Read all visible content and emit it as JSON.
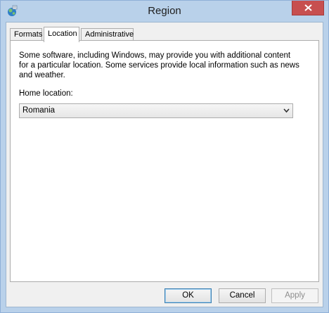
{
  "window": {
    "title": "Region",
    "close_icon": "close-icon",
    "app_icon": "region-globe-icon"
  },
  "tabs": [
    {
      "label": "Formats",
      "active": false
    },
    {
      "label": "Location",
      "active": true
    },
    {
      "label": "Administrative",
      "active": false
    }
  ],
  "location_panel": {
    "description": "Some software, including Windows, may provide you with additional content for a particular location. Some services provide local information such as news and weather.",
    "home_location_label": "Home location:",
    "home_location_value": "Romania"
  },
  "buttons": {
    "ok": "OK",
    "cancel": "Cancel",
    "apply": "Apply"
  },
  "colors": {
    "title_bar": "#b9d1ea",
    "close_button": "#c74f4f",
    "dialog_background": "#f0f0f0"
  }
}
